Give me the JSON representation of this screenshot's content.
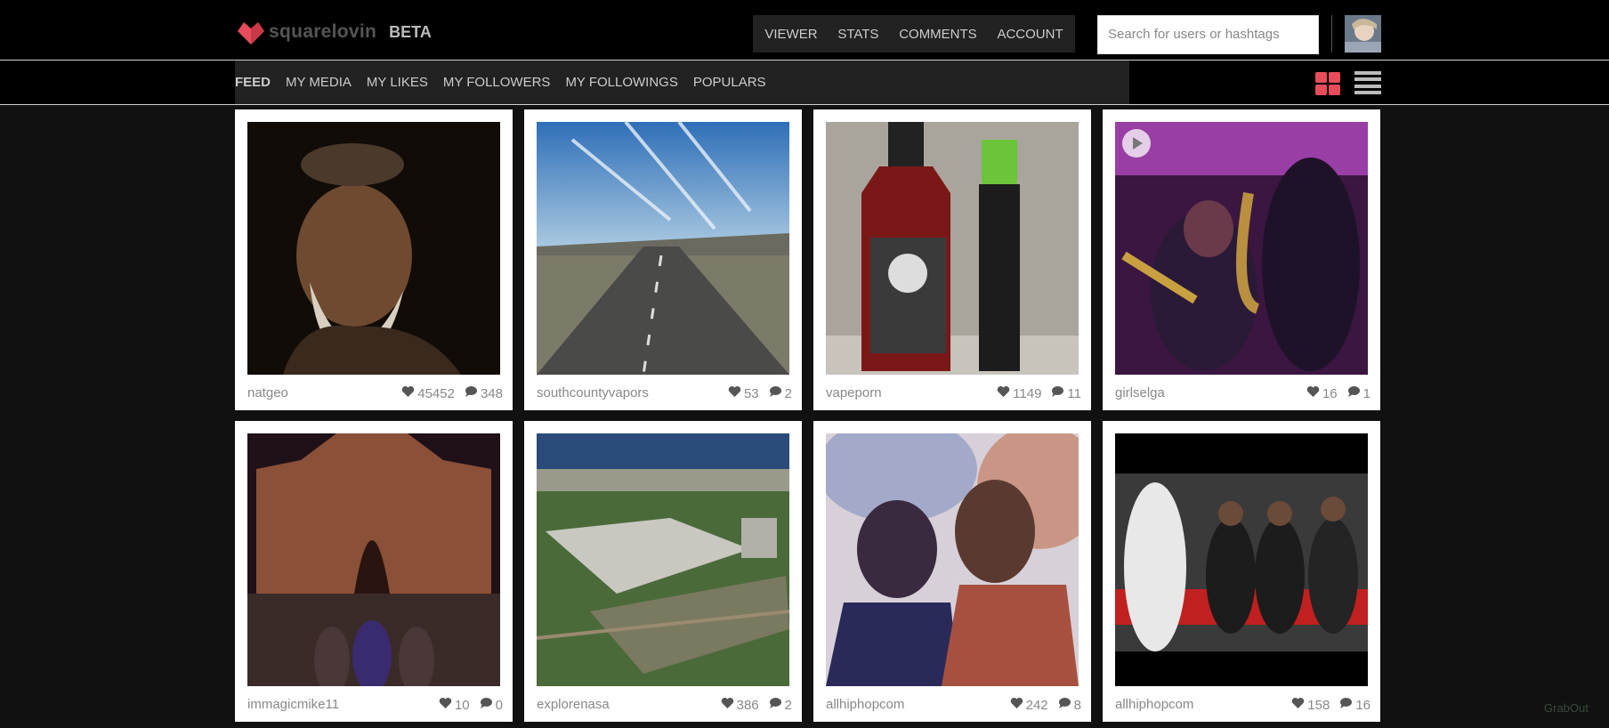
{
  "header": {
    "logo_text": "squarelovin",
    "beta_label": "BETA",
    "topnav": [
      "VIEWER",
      "STATS",
      "COMMENTS",
      "ACCOUNT"
    ],
    "search_placeholder": "Search for users or hashtags"
  },
  "subnav": {
    "items": [
      "FEED",
      "MY MEDIA",
      "MY LIKES",
      "MY FOLLOWERS",
      "MY FOLLOWINGS",
      "POPULARS"
    ],
    "active": "FEED"
  },
  "colors": {
    "accent": "#e74c5a",
    "background": "#111111",
    "bar": "#222222"
  },
  "posts": [
    {
      "user": "natgeo",
      "likes": "45452",
      "comments": "348",
      "image": "portrait-elder-man"
    },
    {
      "user": "southcountyvapors",
      "likes": "53",
      "comments": "2",
      "image": "desert-highway"
    },
    {
      "user": "vapeporn",
      "likes": "1149",
      "comments": "11",
      "image": "eliquid-bottles"
    },
    {
      "user": "girlselga",
      "likes": "16",
      "comments": "1",
      "image": "jazz-band-video"
    },
    {
      "user": "immagicmike11",
      "likes": "10",
      "comments": "0",
      "image": "hotel-night-group"
    },
    {
      "user": "explorenasa",
      "likes": "386",
      "comments": "2",
      "image": "aerial-factory"
    },
    {
      "user": "allhiphopcom",
      "likes": "242",
      "comments": "8",
      "image": "artistic-portrait-duo"
    },
    {
      "user": "allhiphopcom",
      "likes": "158",
      "comments": "16",
      "image": "courtside-basketball"
    }
  ],
  "watermark": "GrabOut"
}
